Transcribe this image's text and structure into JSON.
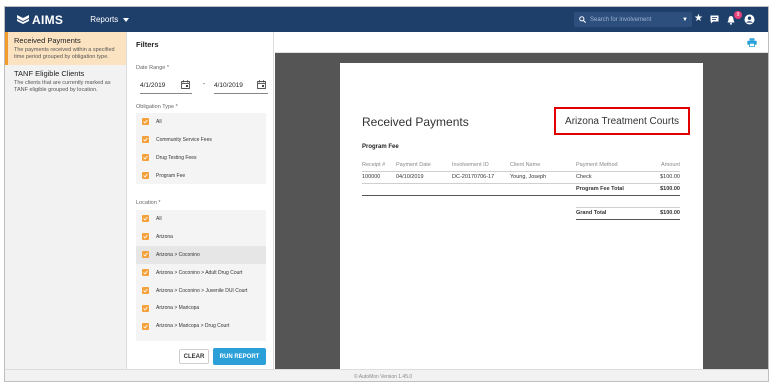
{
  "app": {
    "name": "AIMS",
    "menu_label": "Reports",
    "search_placeholder": "Search for involvement",
    "notification_count": "9"
  },
  "icons": {
    "logo": "shield-chevron-logo",
    "search": "search-icon",
    "star": "star-icon",
    "chat": "chat-icon",
    "bell": "bell-icon",
    "user": "user-icon",
    "calendar": "calendar-icon",
    "print": "print-icon"
  },
  "colors": {
    "topbar": "#1f3f6b",
    "accent": "#f39b2d",
    "button": "#2a9fd8",
    "badge": "#e8417a",
    "highlight_border": "#e00000"
  },
  "leftnav": {
    "items": [
      {
        "title": "Received Payments",
        "desc": "The payments received within a specified time period grouped by obligation type."
      },
      {
        "title": "TANF Eligible Clients",
        "desc": "The clients that are currently marked as TANF eligible grouped by location."
      }
    ]
  },
  "filters": {
    "title": "Filters",
    "date_label": "Date Range *",
    "date_from": "4/1/2019",
    "date_sep": "-",
    "date_to": "4/10/2019",
    "obligation_label": "Obligation Type *",
    "obligation_options": [
      "All",
      "Community Service Fees",
      "Drug Testing Fees",
      "Program Fee"
    ],
    "location_label": "Location *",
    "location_options": [
      "All",
      "Arizona",
      "Arizona > Coconino",
      "Arizona > Coconino > Adult Drug Court",
      "Arizona > Coconino > Juvenile DUI Court",
      "Arizona > Maricopa",
      "Arizona > Maricopa > Drug Court",
      "Arizona > Maricopa > DUI Court"
    ],
    "clear_label": "CLEAR",
    "run_label": "RUN REPORT"
  },
  "report": {
    "title": "Received Payments",
    "highlight": "Arizona Treatment Courts",
    "section": "Program Fee",
    "columns": [
      "Receipt #",
      "Payment Date",
      "Involvement ID",
      "Client Name",
      "Payment Method",
      "Amount"
    ],
    "rows": [
      [
        "100000",
        "04/10/2019",
        "DC-20170706-17",
        "Young, Joseph",
        "Check",
        "$100.00"
      ]
    ],
    "subtotal_label": "Program Fee Total",
    "subtotal_value": "$100.00",
    "grand_label": "Grand Total",
    "grand_value": "$100.00"
  },
  "footer": {
    "version": "© AutoMon Version 1.45.0"
  }
}
